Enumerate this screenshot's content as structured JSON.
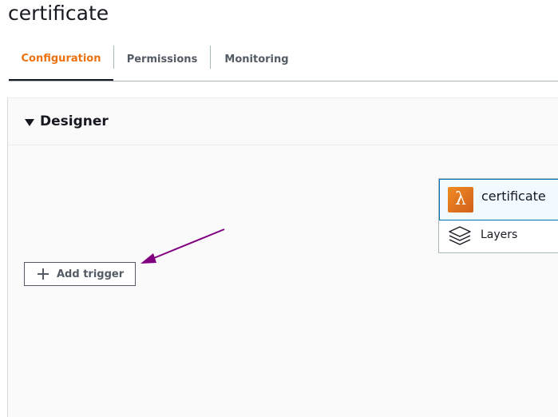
{
  "page": {
    "title": "certificate"
  },
  "tabs": [
    {
      "label": "Configuration",
      "active": true
    },
    {
      "label": "Permissions",
      "active": false
    },
    {
      "label": "Monitoring",
      "active": false
    }
  ],
  "designer": {
    "title": "Designer",
    "add_trigger_label": "Add trigger",
    "function": {
      "name": "certificate",
      "icon": "lambda-icon",
      "icon_glyph": "λ"
    },
    "layers_label": "Layers"
  },
  "annotation": {
    "arrow_color": "#800080"
  },
  "colors": {
    "active_tab": "#ec7211",
    "lambda_orange": "#e07b22",
    "selected_border": "#0073bb"
  }
}
